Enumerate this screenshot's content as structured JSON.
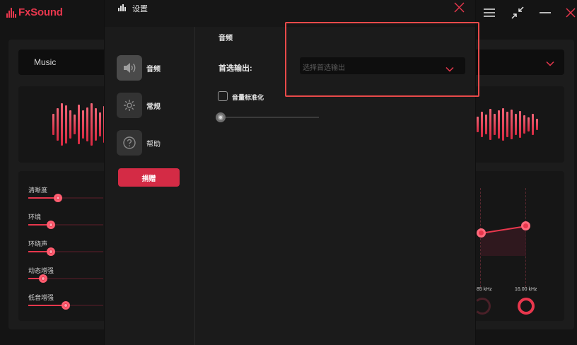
{
  "app": {
    "logo_text": "FxSound",
    "preset": "Music",
    "effects": [
      {
        "label": "清晰度",
        "value": 0.4
      },
      {
        "label": "环境",
        "value": 0.3
      },
      {
        "label": "环绕声",
        "value": 0.3
      },
      {
        "label": "动态增强",
        "value": 0.2
      },
      {
        "label": "低音增强",
        "value": 0.5
      }
    ],
    "eq_freqs": [
      "85 kHz",
      "16.00 kHz"
    ]
  },
  "dialog": {
    "title": "设置",
    "nav": [
      {
        "label": "音频",
        "icon": "speaker-icon"
      },
      {
        "label": "常规",
        "icon": "gear-icon"
      },
      {
        "label": "帮助",
        "icon": "help-icon"
      }
    ],
    "donate_label": "捐赠",
    "section_title": "音频",
    "output_label": "首选输出:",
    "output_placeholder": "选择首选输出",
    "normalize_label": "音量标准化",
    "normalize_checked": false
  },
  "colors": {
    "accent": "#e8374d",
    "highlight": "#e84a4a"
  }
}
